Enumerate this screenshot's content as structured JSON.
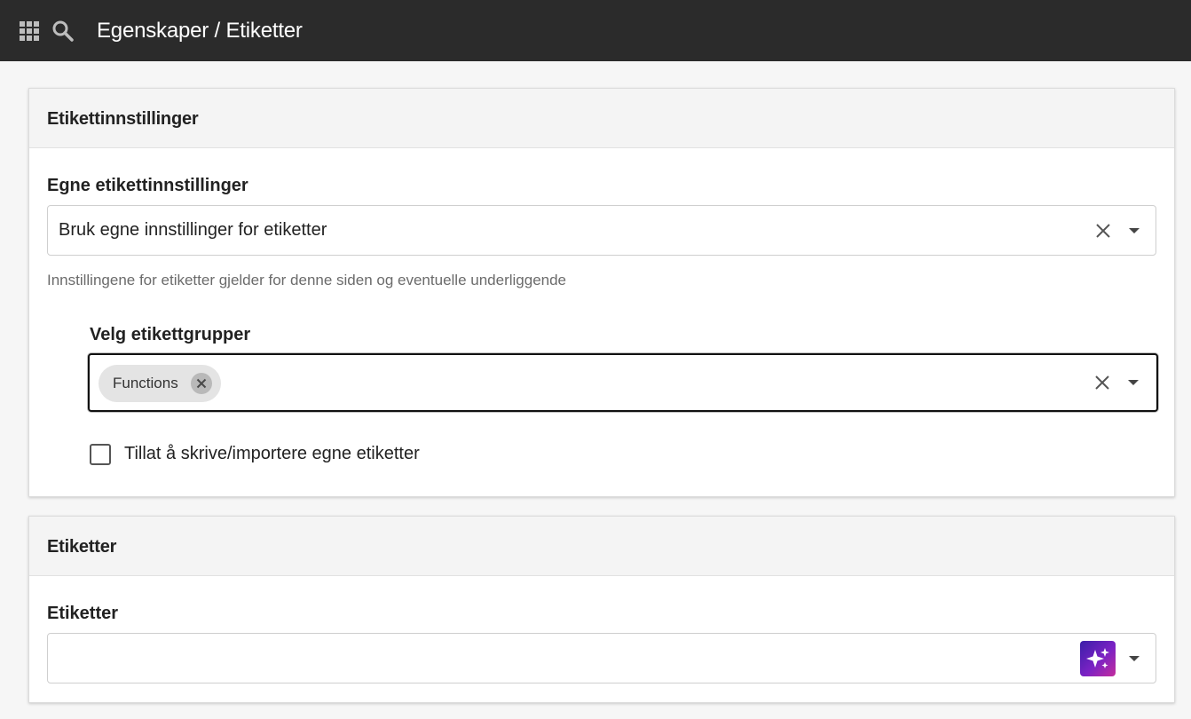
{
  "header": {
    "title": "Egenskaper / Etiketter",
    "apps_icon": "grid-apps-icon",
    "search_icon": "search-icon"
  },
  "settings_card": {
    "title": "Etikettinnstillinger",
    "own_settings": {
      "label": "Egne etikettinnstillinger",
      "value": "Bruk egne innstillinger for etiketter",
      "helper": "Innstillingene for etiketter gjelder for denne siden og eventuelle underliggende"
    },
    "groups": {
      "label": "Velg etikettgrupper",
      "chips": [
        "Functions"
      ]
    },
    "allow_custom": {
      "label": "Tillat å skrive/importere egne etiketter",
      "checked": false
    }
  },
  "tags_card": {
    "title": "Etiketter",
    "field": {
      "label": "Etiketter",
      "value": ""
    }
  },
  "colors": {
    "topbar": "#2b2b2b",
    "ai_gradient": [
      "#3a1fa8",
      "#c42d9c"
    ]
  }
}
